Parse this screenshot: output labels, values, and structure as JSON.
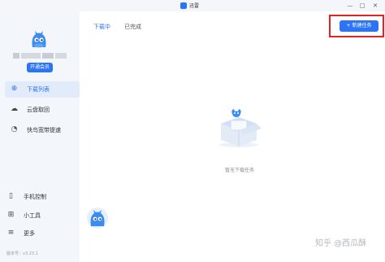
{
  "window": {
    "title": "迅雷",
    "controls": [
      "—",
      "□",
      "✕"
    ]
  },
  "sidebar": {
    "vip_button": "开通会员",
    "items": [
      {
        "label": "下载列表",
        "icon": "download-icon",
        "active": true
      },
      {
        "label": "云盘取回",
        "icon": "cloud-icon",
        "active": false
      },
      {
        "label": "快鸟宽带提速",
        "icon": "speedometer-icon",
        "active": false
      }
    ],
    "bottom_items": [
      {
        "label": "手机控制",
        "icon": "phone-icon"
      },
      {
        "label": "小工具",
        "icon": "grid-icon"
      },
      {
        "label": "更多",
        "icon": "menu-icon"
      }
    ],
    "version": "版本号：v3.23.1"
  },
  "main": {
    "tabs": [
      {
        "label": "下载中",
        "active": true
      },
      {
        "label": "已完成",
        "active": false
      }
    ],
    "new_task_label": "+ 新建任务",
    "empty_text": "暂无下载任务"
  },
  "watermark": "知乎 @西瓜酥",
  "colors": {
    "accent": "#2c74f6",
    "highlight": "#e02424",
    "sidebar_bg": "#f3f6fb"
  }
}
